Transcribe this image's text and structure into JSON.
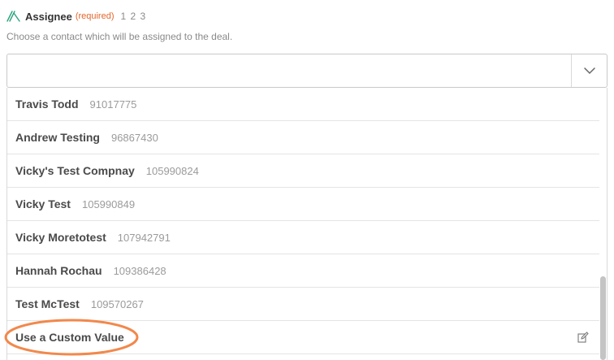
{
  "field": {
    "label": "Assignee",
    "required": "(required)",
    "steps": "1 2 3",
    "help": "Choose a contact which will be assigned to the deal.",
    "search_value": ""
  },
  "icons": {
    "field_icon": "zapier-field-icon",
    "toggle_icon": "chevron-down-icon",
    "custom_icon": "edit-icon"
  },
  "options": [
    {
      "name": "Travis Todd",
      "id": "91017775"
    },
    {
      "name": "Andrew Testing",
      "id": "96867430"
    },
    {
      "name": "Vicky's Test Compnay",
      "id": "105990824"
    },
    {
      "name": "Vicky Test",
      "id": "105990849"
    },
    {
      "name": "Vicky Moretotest",
      "id": "107942791"
    },
    {
      "name": "Hannah Rochau",
      "id": "109386428"
    },
    {
      "name": "Test McTest",
      "id": "109570267"
    }
  ],
  "custom_option": {
    "label": "Use a Custom Value"
  },
  "colors": {
    "required": "#e4662b",
    "icon": "#2aa37d",
    "highlight": "#f2884b"
  }
}
